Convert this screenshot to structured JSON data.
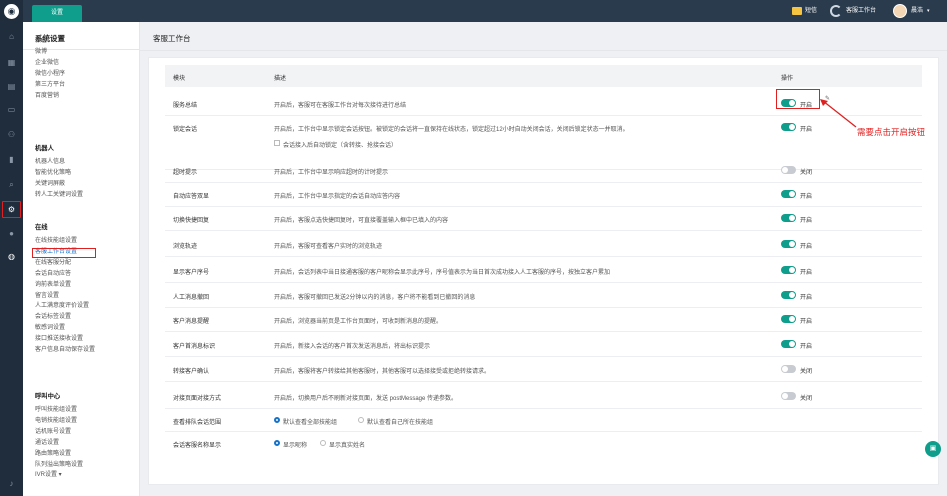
{
  "topbar": {
    "active_tab": "设置",
    "sms_label": "短信",
    "workstation_label": "客服工作台",
    "user_name": "晨浩"
  },
  "sidebar": {
    "title": "系统设置",
    "groups": [
      {
        "label": "",
        "items": [
          "微信",
          "微博",
          "企业微信",
          "微信小程序",
          "第三方平台",
          "百度营销"
        ]
      },
      {
        "label": "机器人",
        "items": [
          "机器人信息",
          "智能优化策略",
          "关键词屏蔽",
          "转人工关键词设置"
        ]
      },
      {
        "label": "在线",
        "items": [
          "在线技能组设置",
          "客服工作台设置",
          "在线客服分配",
          "会话自动应答",
          "询前表单设置",
          "留言设置",
          "人工满意度评价设置",
          "会话标签设置",
          "敏感词设置",
          "接口推送接收设置",
          "客户信息自动保存设置"
        ]
      },
      {
        "label": "呼叫中心",
        "items": [
          "呼叫技能组设置",
          "电销技能组设置",
          "话机账号设置",
          "通话设置",
          "路由策略设置",
          "队列溢出策略设置",
          "IVR设置 ▾"
        ]
      }
    ]
  },
  "main": {
    "title": "客服工作台",
    "columns": {
      "module": "模块",
      "desc": "描述",
      "action": "操作"
    },
    "rows": [
      {
        "name": "服务总结",
        "desc": "开启后，客服可在客服工作台对每次接待进行总结",
        "on": true,
        "label": "开启"
      },
      {
        "name": "锁定会话",
        "desc": "开启后，工作台中显示锁定会话按钮。被锁定的会话将一直保持在线状态，锁定超过12小时自动关闭会话，关闭后锁定状态一并取消。",
        "on": true,
        "label": "开启"
      },
      {
        "name": "超时提示",
        "desc": "开启后，工作台中显示响应超时的计时提示",
        "on": false,
        "label": "关闭"
      },
      {
        "name": "自动应答双显",
        "desc": "开启后，工作台中显示指定的会话自动应答内容",
        "on": true,
        "label": "开启"
      },
      {
        "name": "切换快捷回复",
        "desc": "开启后，客服点选快捷回复时，可直接覆盖输入框中已填入的内容",
        "on": true,
        "label": "开启"
      },
      {
        "name": "浏览轨迹",
        "desc": "开启后，客服可查看客户实时的浏览轨迹",
        "on": true,
        "label": "开启"
      },
      {
        "name": "显示客户序号",
        "desc": "开启后，会话列表中当日接通客服的客户昵称会显示此序号，序号值表示为当日首次成功接入人工客服的序号，按独立客户累加",
        "on": true,
        "label": "开启"
      },
      {
        "name": "人工消息撤回",
        "desc": "开启后，客服可撤回已发送2分钟以内的消息，客户将不能看到已撤回的消息",
        "on": true,
        "label": "开启"
      },
      {
        "name": "客户消息提醒",
        "desc": "开启后，浏览器当前页是工作台页面时，可收到新消息的提醒。",
        "on": true,
        "label": "开启"
      },
      {
        "name": "客户首消息标识",
        "desc": "开启后，新接入会话的客户首次发送消息后，将出标识提示",
        "on": true,
        "label": "开启"
      },
      {
        "name": "转接客户确认",
        "desc": "开启后，客服将客户转接给其他客服时，其他客服可以选择接受或拒绝转接请求。",
        "on": false,
        "label": "关闭"
      },
      {
        "name": "对接页面对接方式",
        "desc": "开启后，切换用户后不刷新对接页面，发送 postMessage 传递参数。",
        "on": false,
        "label": "关闭"
      }
    ],
    "lock_checkbox_label": "会话接入后自动锁定（含转接、抢接会话）",
    "queue_row": {
      "name": "查看排队会话范围",
      "options": [
        "默认查看全部技能组",
        "默认查看自己所在技能组"
      ],
      "selected": 0
    },
    "display_row": {
      "name": "会话客服名称显示",
      "options": [
        "显示昵称",
        "显示真实姓名"
      ],
      "selected": 0
    }
  },
  "annotation": "需要点击开启按钮"
}
